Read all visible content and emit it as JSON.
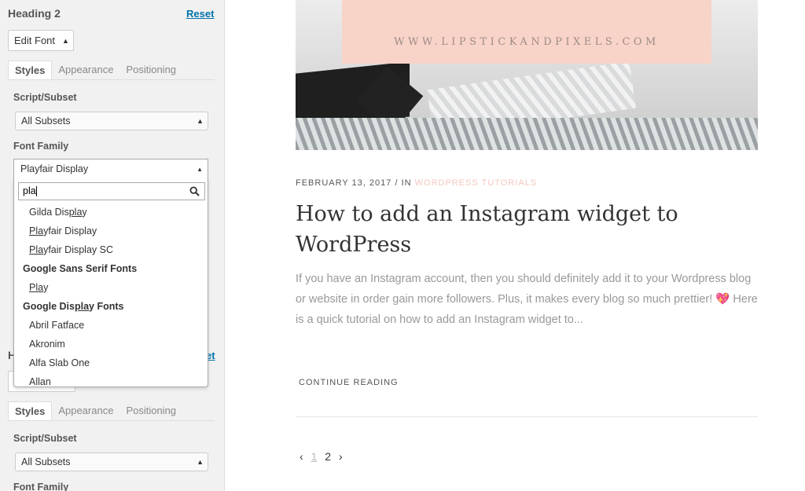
{
  "sidebar": {
    "heading": "Heading 2",
    "reset_label": "Reset",
    "edit_font_label": "Edit Font",
    "tabs": [
      "Styles",
      "Appearance",
      "Positioning"
    ],
    "script_subset_label": "Script/Subset",
    "script_subset_value": "All Subsets",
    "font_family_label": "Font Family",
    "font_family_value": "Playfair Display",
    "search_value": "pla",
    "options": [
      {
        "type": "option",
        "pre": "Gilda Dis",
        "match": "pla",
        "post": "y"
      },
      {
        "type": "option",
        "pre": "",
        "match": "Pla",
        "post": "yfair Display"
      },
      {
        "type": "option",
        "pre": "",
        "match": "Pla",
        "post": "yfair Display SC"
      },
      {
        "type": "group",
        "pre": "Google Sans Serif Fonts",
        "match": "",
        "post": ""
      },
      {
        "type": "option",
        "pre": "",
        "match": "Pla",
        "post": "y"
      },
      {
        "type": "group",
        "pre": "Google Dis",
        "match": "pla",
        "post": "y Fonts"
      },
      {
        "type": "option",
        "pre": "Abril Fatface",
        "match": "",
        "post": ""
      },
      {
        "type": "option",
        "pre": "Akronim",
        "match": "",
        "post": ""
      },
      {
        "type": "option",
        "pre": "Alfa Slab One",
        "match": "",
        "post": ""
      },
      {
        "type": "option",
        "pre": "Allan",
        "match": "",
        "post": ""
      }
    ],
    "second": {
      "heading_partial": "H",
      "reset_partial": "et",
      "tabs": [
        "Styles",
        "Appearance",
        "Positioning"
      ],
      "script_subset_label": "Script/Subset",
      "script_subset_value": "All Subsets",
      "font_family_label": "Font Family"
    }
  },
  "post": {
    "hero_url": "WWW.LIPSTICKANDPIXELS.COM",
    "date": "FEBRUARY 13, 2017",
    "sep": "/ IN",
    "category": "WORDPRESS TUTORIALS",
    "title": "How to add an Instagram widget to WordPress",
    "excerpt_before": "If you have an Instagram account, then you should definitely add it to your Wordpress blog or website in order gain more followers. Plus, it makes every blog so much prettier!",
    "heart": "💖",
    "excerpt_after": " Here is a quick tutorial on how to add an Instagram widget to...",
    "read_more": "CONTINUE READING"
  },
  "pagination": {
    "prev": "‹",
    "pages": [
      "1",
      "2"
    ],
    "next": "›"
  },
  "colors": {
    "accent": "#0073aa",
    "category": "#f4c7bd",
    "hero_pink": "#f8d3c8"
  }
}
